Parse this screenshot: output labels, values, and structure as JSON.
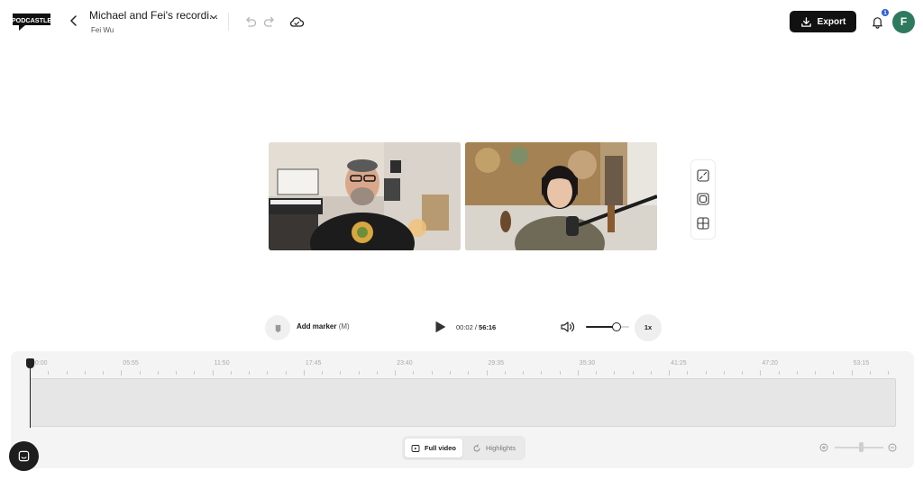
{
  "app": {
    "logo_text": "PODCASTLE",
    "project_title": "Michael and Fei's recordi...",
    "owner": "Fei Wu"
  },
  "header": {
    "export_label": "Export",
    "notification_count": "1",
    "avatar_initial": "F"
  },
  "player": {
    "marker_label": "Add marker",
    "marker_shortcut": "(M)",
    "time_current": "00:02",
    "time_separator": " / ",
    "time_total": "56:16",
    "volume_level": 0.7,
    "speed_label": "1x"
  },
  "timeline": {
    "ticks": [
      "00:00",
      "05:55",
      "11:50",
      "17:45",
      "23:40",
      "29:35",
      "35:30",
      "41:25",
      "47:20",
      "53:15"
    ],
    "view_options": {
      "full_video": "Full video",
      "highlights": "Highlights"
    }
  },
  "icons": {
    "back": "chevron-left-icon",
    "title_dropdown": "chevron-down-icon",
    "undo": "undo-icon",
    "redo": "redo-icon",
    "cloud": "cloud-sync-icon",
    "export": "download-icon",
    "notifications": "bell-icon",
    "layout1": "layout-split-icon",
    "layout2": "layout-speaker-icon",
    "layout3": "layout-grid-icon",
    "marker": "marker-flag-icon",
    "play": "play-icon",
    "volume": "volume-icon",
    "zoom_in": "zoom-in-icon",
    "zoom_out": "zoom-out-icon",
    "chat": "chat-icon"
  },
  "colors": {
    "accent": "#111111",
    "avatar_bg": "#2f7a5e",
    "badge": "#2b5fd9"
  }
}
